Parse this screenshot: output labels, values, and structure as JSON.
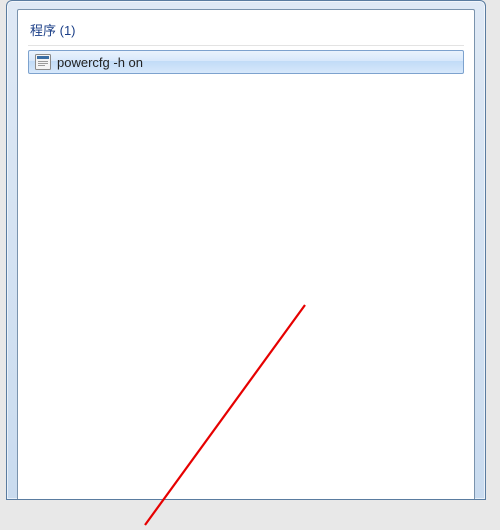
{
  "section": {
    "header": "程序 (1)"
  },
  "results": [
    {
      "label": "powercfg -h on",
      "icon": "program-icon"
    }
  ]
}
